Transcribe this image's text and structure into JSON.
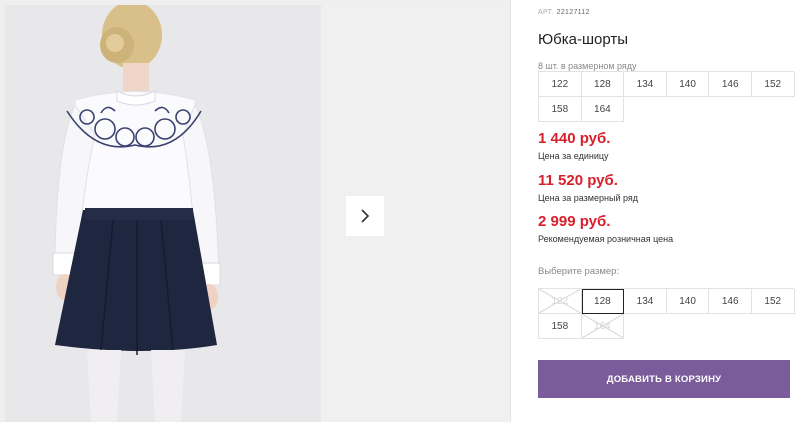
{
  "product": {
    "art_label": "АРТ.",
    "art_number": "22127112",
    "title": "Юбка-шорты",
    "pack_note": "8 шт. в размерном ряду"
  },
  "pack_sizes": [
    "122",
    "128",
    "134",
    "140",
    "146",
    "152",
    "158",
    "164"
  ],
  "prices": [
    {
      "value": "1 440 руб.",
      "caption": "Цена за единицу"
    },
    {
      "value": "11 520 руб.",
      "caption": "Цена за размерный ряд"
    },
    {
      "value": "2 999 руб.",
      "caption": "Рекомендуемая розничная цена"
    }
  ],
  "size_picker": {
    "label": "Выберите размер:",
    "options": [
      {
        "label": "122",
        "state": "disabled"
      },
      {
        "label": "128",
        "state": "selected"
      },
      {
        "label": "134",
        "state": "available"
      },
      {
        "label": "140",
        "state": "available"
      },
      {
        "label": "146",
        "state": "available"
      },
      {
        "label": "152",
        "state": "available"
      },
      {
        "label": "158",
        "state": "available"
      },
      {
        "label": "164",
        "state": "disabled"
      }
    ]
  },
  "cart_button": {
    "label": "ДОБАВИТЬ В КОРЗИНУ"
  },
  "gallery": {
    "next_icon": "chevron-right-icon"
  },
  "colors": {
    "price": "#d8202d",
    "button": "#7a5c9a",
    "skirt": "#1f2740",
    "embroidery": "#3a4270"
  }
}
